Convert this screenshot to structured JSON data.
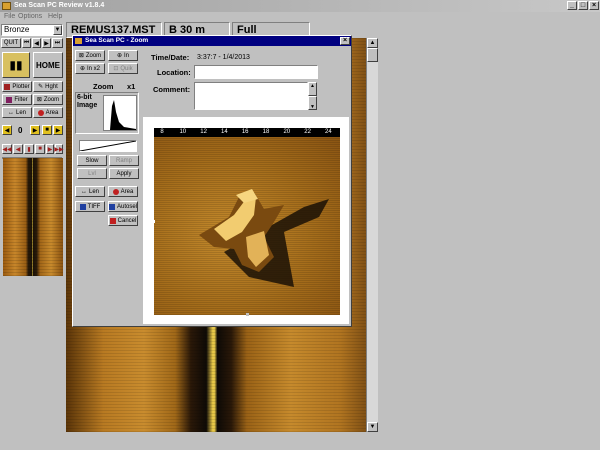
{
  "app": {
    "title": "Sea Scan PC Review v1.8.4"
  },
  "menu": [
    "File",
    "Options",
    "Help"
  ],
  "header": {
    "filename": "REMUS137.MST",
    "range": "B 30 m",
    "mode": "Full"
  },
  "left": {
    "palette": "Bronze",
    "quit": "QUIT",
    "home": "HOME",
    "plotter": "Plotter",
    "hght": "Hght",
    "filter": "Filter",
    "zoom": "Zoom",
    "len": "Len",
    "area": "Area",
    "counter": "0"
  },
  "dialog": {
    "title": "Sea Scan PC - Zoom",
    "zoom_btn": "Zoom",
    "in_btn": "In",
    "in_x2": "In x2",
    "quick": "Quik",
    "zoom_label": "Zoom",
    "zoom_level": "x1",
    "bit_label": "6-bit",
    "image_label": "Image",
    "slow": "Slow",
    "ramp": "Ramp",
    "lvl": "Lvl",
    "apply": "Apply",
    "len": "Len",
    "area": "Area",
    "tiff": "TIFF",
    "autosel": "Autosel",
    "cancel": "Cancel",
    "time_label": "Time/Date:",
    "time_value": "3:37:7 - 1/4/2013",
    "location_label": "Location:",
    "location_value": "",
    "comment_label": "Comment:",
    "comment_value": "",
    "ruler": [
      "8",
      "10",
      "12",
      "14",
      "16",
      "18",
      "20",
      "22",
      "24"
    ]
  }
}
